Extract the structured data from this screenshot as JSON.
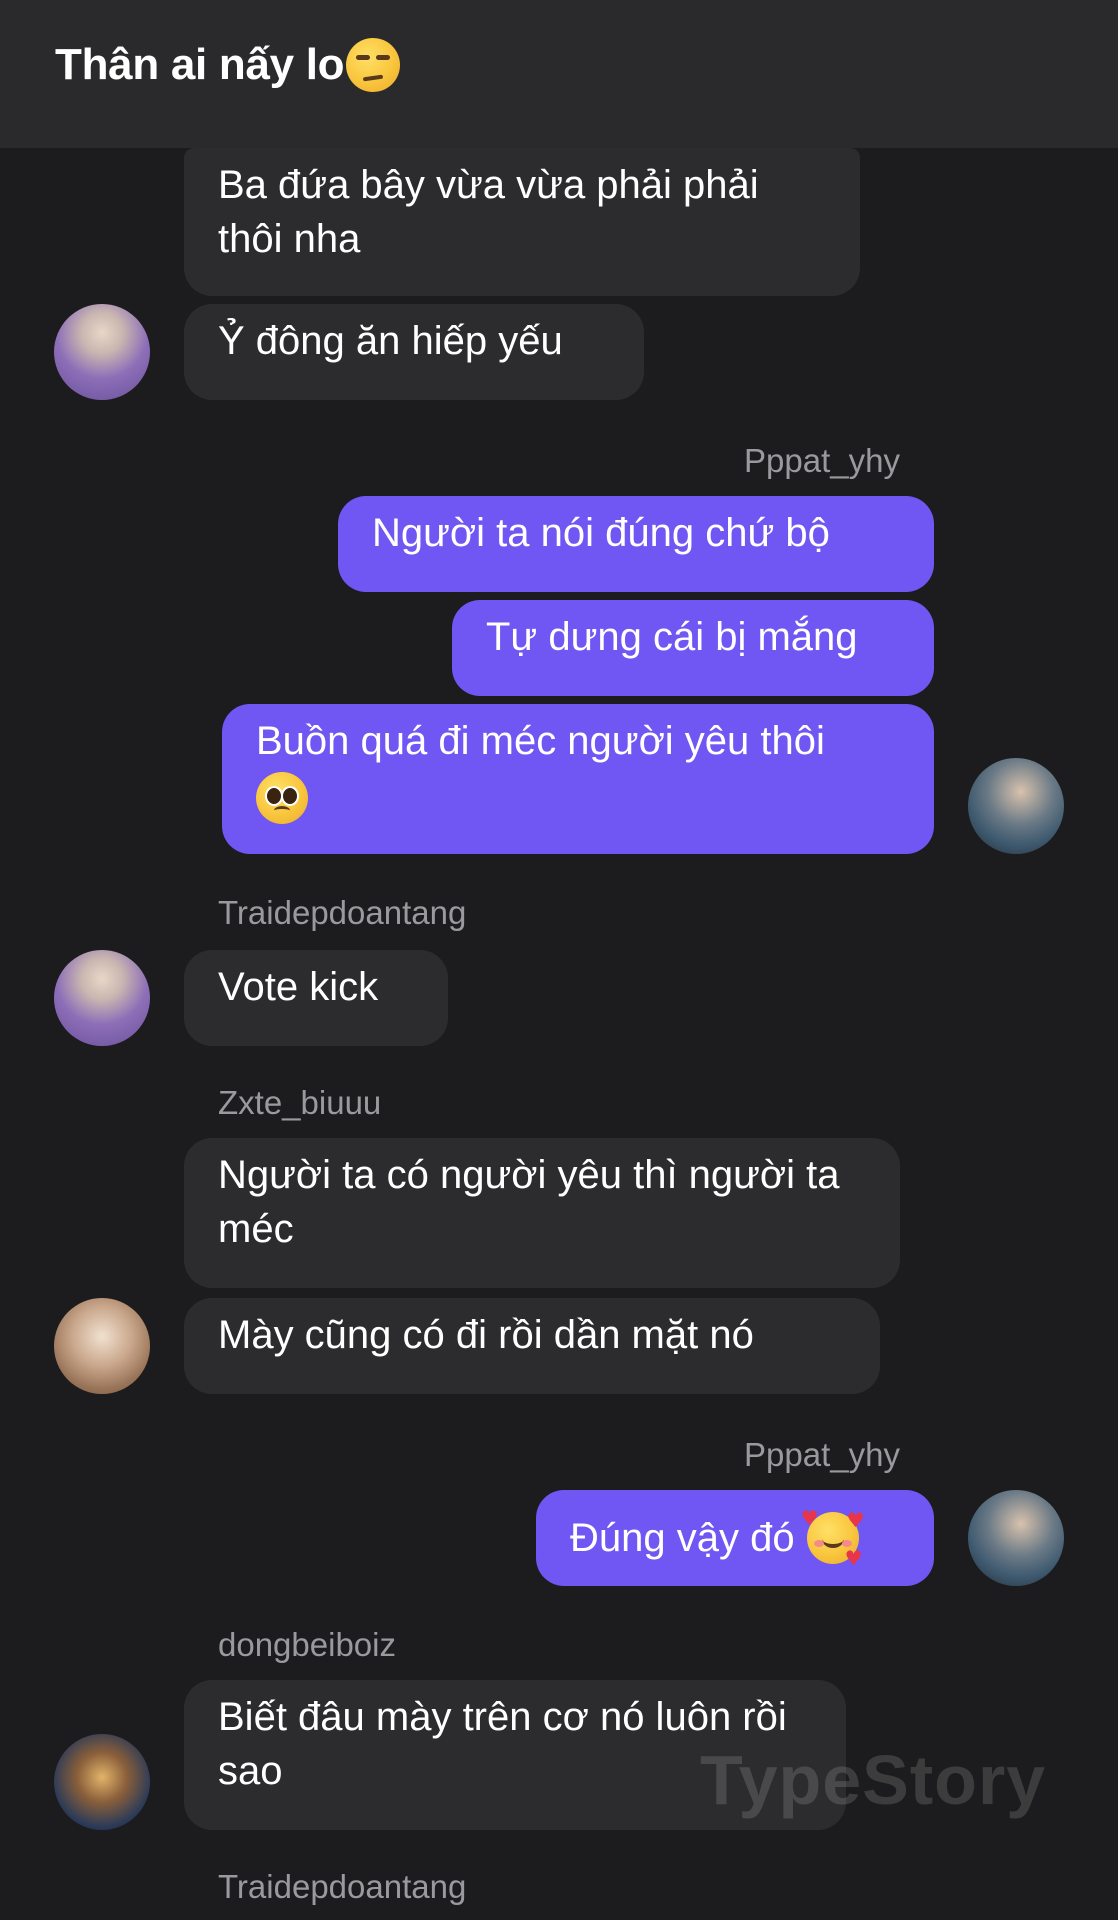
{
  "header": {
    "title": "Thân ai nấy lo",
    "title_emoji": "unamused-face-emoji"
  },
  "messages": [
    {
      "text": "Ba đứa bây vừa vừa phải phải thôi nha"
    },
    {
      "text": "Ỷ đông ăn hiếp yếu"
    },
    {
      "sender": "Pppat_yhy"
    },
    {
      "text": "Người ta nói đúng chứ bộ"
    },
    {
      "text": "Tự dưng cái bị mắng"
    },
    {
      "text": "Buồn quá đi méc người yêu thôi"
    },
    {
      "sender": "Traidepdoantang"
    },
    {
      "text": "Vote kick"
    },
    {
      "sender": "Zxte_biuuu"
    },
    {
      "text": "Người ta có người yêu thì người ta méc"
    },
    {
      "text": "Mày cũng có đi rồi dần mặt nó"
    },
    {
      "sender": "Pppat_yhy"
    },
    {
      "text": "Đúng vậy đó"
    },
    {
      "sender": "dongbeiboiz"
    },
    {
      "text": "Biết đâu mày trên cơ nó luôn rồi sao"
    },
    {
      "sender": "Traidepdoantang"
    }
  ],
  "watermark": "TypeStory",
  "colors": {
    "background": "#1c1c1e",
    "header": "#2a2a2c",
    "incoming_bubble": "#2c2c2e",
    "outgoing_bubble": "#7056f2",
    "name": "#9a9a9e"
  }
}
